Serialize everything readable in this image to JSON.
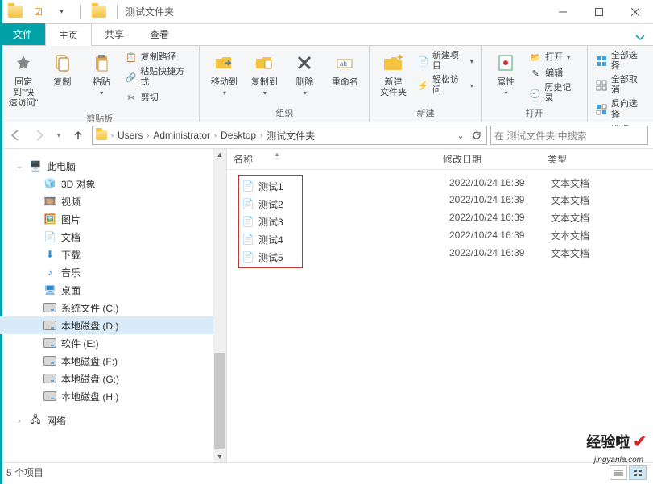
{
  "window": {
    "title": "测试文件夹"
  },
  "tabs": {
    "file": "文件",
    "home": "主页",
    "share": "共享",
    "view": "查看"
  },
  "ribbon": {
    "clipboard": {
      "pin": "固定到\"快\n速访问\"",
      "copy": "复制",
      "paste": "粘贴",
      "copy_path": "复制路径",
      "paste_shortcut": "粘贴快捷方式",
      "cut": "剪切",
      "label": "剪贴板"
    },
    "organize": {
      "move_to": "移动到",
      "copy_to": "复制到",
      "delete": "删除",
      "rename": "重命名",
      "label": "组织"
    },
    "new": {
      "new_folder": "新建\n文件夹",
      "new_item": "新建项目",
      "easy_access": "轻松访问",
      "label": "新建"
    },
    "open": {
      "properties": "属性",
      "open": "打开",
      "edit": "编辑",
      "history": "历史记录",
      "label": "打开"
    },
    "select": {
      "select_all": "全部选择",
      "select_none": "全部取消",
      "invert": "反向选择",
      "label": "选择"
    }
  },
  "breadcrumb": [
    "Users",
    "Administrator",
    "Desktop",
    "测试文件夹"
  ],
  "search": {
    "placeholder": "在 测试文件夹 中搜索"
  },
  "columns": {
    "name": "名称",
    "date": "修改日期",
    "type": "类型"
  },
  "tree": {
    "this_pc": "此电脑",
    "objects3d": "3D 对象",
    "videos": "视频",
    "pictures": "图片",
    "documents": "文档",
    "downloads": "下载",
    "music": "音乐",
    "desktop": "桌面",
    "drive_c": "系统文件 (C:)",
    "drive_d": "本地磁盘 (D:)",
    "drive_e": "软件 (E:)",
    "drive_f": "本地磁盘 (F:)",
    "drive_g": "本地磁盘 (G:)",
    "drive_h": "本地磁盘 (H:)",
    "network": "网络"
  },
  "files": [
    {
      "name": "测试1",
      "date": "2022/10/24 16:39",
      "type": "文本文档"
    },
    {
      "name": "测试2",
      "date": "2022/10/24 16:39",
      "type": "文本文档"
    },
    {
      "name": "测试3",
      "date": "2022/10/24 16:39",
      "type": "文本文档"
    },
    {
      "name": "测试4",
      "date": "2022/10/24 16:39",
      "type": "文本文档"
    },
    {
      "name": "测试5",
      "date": "2022/10/24 16:39",
      "type": "文本文档"
    }
  ],
  "status": {
    "count": "5 个项目"
  },
  "watermark": {
    "brand": "经验啦",
    "url": "jingyanla.com"
  }
}
